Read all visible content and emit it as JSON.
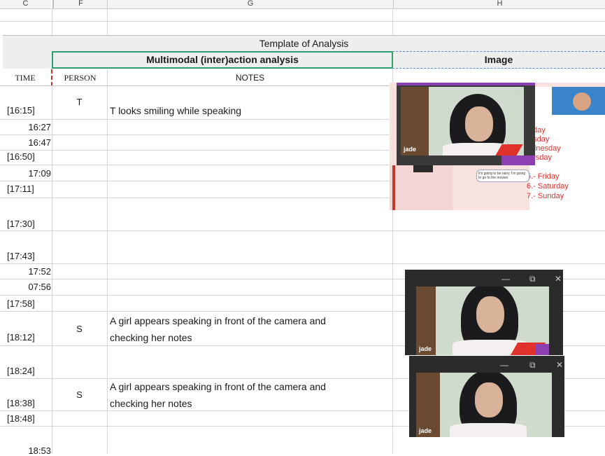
{
  "sheet": {
    "column_letters": [
      "C",
      "F",
      "G",
      "H"
    ],
    "title": "Template of Analysis",
    "group_header_left": "Multimodal (inter)action analysis",
    "group_header_right": "Image",
    "col_time": "TIME",
    "col_person": "PERSON",
    "col_notes": "NOTES"
  },
  "rows": [
    {
      "time": "[16:15]",
      "person": "T",
      "note": "T looks smiling while speaking"
    },
    {
      "time": "16:27",
      "person": "",
      "note": ""
    },
    {
      "time": "16:47",
      "person": "",
      "note": ""
    },
    {
      "time": "[16:50]",
      "person": "",
      "note": ""
    },
    {
      "time": "17:09",
      "person": "",
      "note": ""
    },
    {
      "time": "[17:11]",
      "person": "",
      "note": ""
    },
    {
      "time": "[17:30]",
      "person": "",
      "note": ""
    },
    {
      "time": "[17:43]",
      "person": "",
      "note": ""
    },
    {
      "time": "17:52",
      "person": "",
      "note": ""
    },
    {
      "time": "07:56",
      "person": "",
      "note": ""
    },
    {
      "time": "[17:58]",
      "person": "",
      "note": ""
    },
    {
      "time": "[18:12]",
      "person": "S",
      "note_line1": "A girl appears speaking in front of the camera and",
      "note_line2": "checking her notes"
    },
    {
      "time": "[18:24]",
      "person": "",
      "note": ""
    },
    {
      "time": "[18:38]",
      "person": "S",
      "note_line1": "A girl appears speaking in front of the camera and",
      "note_line2": "checking her notes"
    },
    {
      "time": "[18:48]",
      "person": "",
      "note": ""
    },
    {
      "time": "18:53",
      "person": "",
      "note": ""
    }
  ],
  "images": {
    "webcam_label": "jade",
    "slide_days": [
      "nday",
      "esday",
      "ednesday",
      "ursday",
      "5.- Friday",
      "6.- Saturday",
      "7.- Sunday"
    ],
    "speech_bubble": "It's going to be rainy. I'm going to go to the movies",
    "window_minimize": "—",
    "window_restore": "⧉",
    "window_close": "✕"
  },
  "colors": {
    "green_border": "#2e9e6e",
    "blue_dashed": "#4a90d9",
    "red_dashed": "#c0392b",
    "slide_red": "#e0312b",
    "accent_purple": "#8c3fb0"
  }
}
